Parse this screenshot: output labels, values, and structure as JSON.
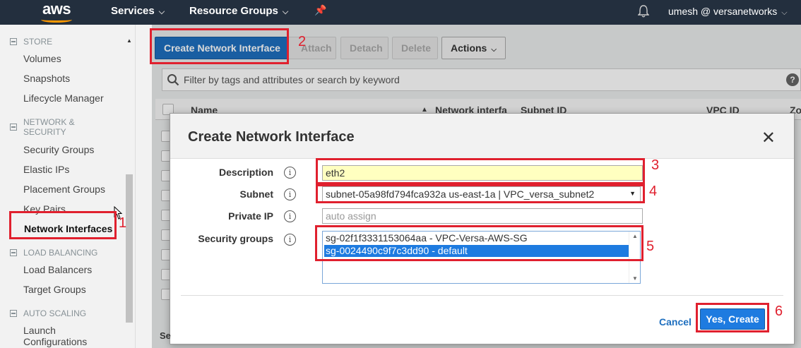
{
  "topnav": {
    "logo": "aws",
    "services": "Services",
    "resource_groups": "Resource Groups",
    "user": "umesh @ versanetworks"
  },
  "sidebar": {
    "store_header": "STORE",
    "volumes": "Volumes",
    "snapshots": "Snapshots",
    "lifecycle": "Lifecycle Manager",
    "netsec_header": "NETWORK & SECURITY",
    "security_groups": "Security Groups",
    "elastic_ips": "Elastic IPs",
    "placement_groups": "Placement Groups",
    "key_pairs": "Key Pairs",
    "network_interfaces": "Network Interfaces",
    "lb_header": "LOAD BALANCING",
    "load_balancers": "Load Balancers",
    "target_groups": "Target Groups",
    "as_header": "AUTO SCALING",
    "launch_configs": "Launch Configurations"
  },
  "toolbar": {
    "create": "Create Network Interface",
    "attach": "Attach",
    "detach": "Detach",
    "delete": "Delete",
    "actions": "Actions"
  },
  "filter": {
    "placeholder": "Filter by tags and attributes or search by keyword"
  },
  "table": {
    "col_name": "Name",
    "col_netif": "Network interfa",
    "col_subnet": "Subnet ID",
    "col_vpc": "VPC ID",
    "col_zone": "Zo"
  },
  "modal": {
    "title": "Create Network Interface",
    "description_label": "Description",
    "description_value": "eth2",
    "subnet_label": "Subnet",
    "subnet_value": "subnet-05a98fd794fca932a us-east-1a | VPC_versa_subnet2",
    "private_ip_label": "Private IP",
    "private_ip_placeholder": "auto assign",
    "sg_label": "Security groups",
    "sg_options": [
      "sg-02f1f3331153064aa - VPC-Versa-AWS-SG",
      "sg-0024490c9f7c3dd90 - default"
    ],
    "cancel": "Cancel",
    "create": "Yes, Create"
  },
  "annotations": [
    "1",
    "2",
    "3",
    "4",
    "5",
    "6"
  ],
  "colors": {
    "nav_bg": "#232f3e",
    "primary": "#1e6fbf",
    "selection": "#1e7be0",
    "annotation": "#e0202e"
  }
}
